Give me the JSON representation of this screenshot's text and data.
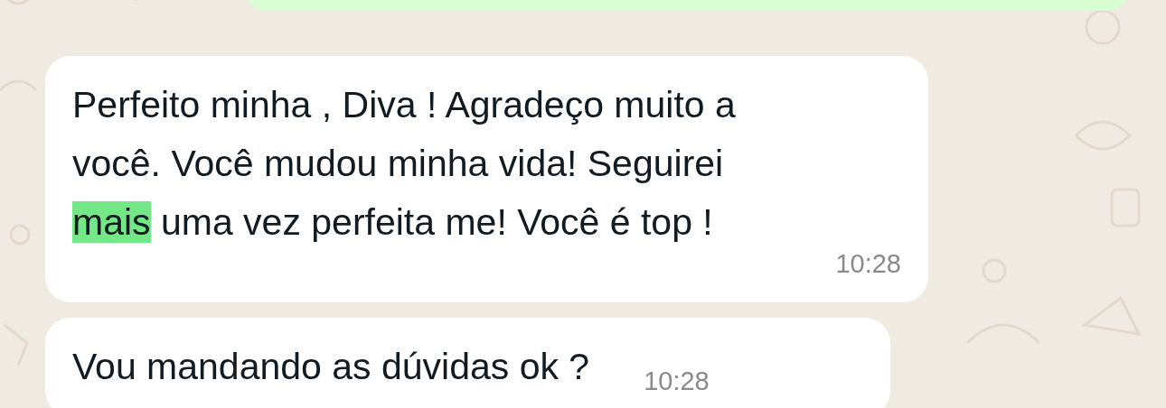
{
  "messages": [
    {
      "kind": "outgoing"
    },
    {
      "kind": "incoming",
      "lines": [
        [
          {
            "text": "Perfeito minha , Diva ! Agradeço muito a",
            "highlighted": false
          }
        ],
        [
          {
            "text": "você. Você mudou minha vida! Seguirei",
            "highlighted": false
          }
        ],
        [
          {
            "text": "mais",
            "highlighted": true
          },
          {
            "text": " uma vez perfeita me! Você é top !",
            "highlighted": false
          }
        ]
      ],
      "time": "10:28"
    },
    {
      "kind": "incoming",
      "lines": [
        [
          {
            "text": "Vou mandando as dúvidas ok ?",
            "highlighted": false
          }
        ]
      ],
      "time": "10:28"
    }
  ]
}
